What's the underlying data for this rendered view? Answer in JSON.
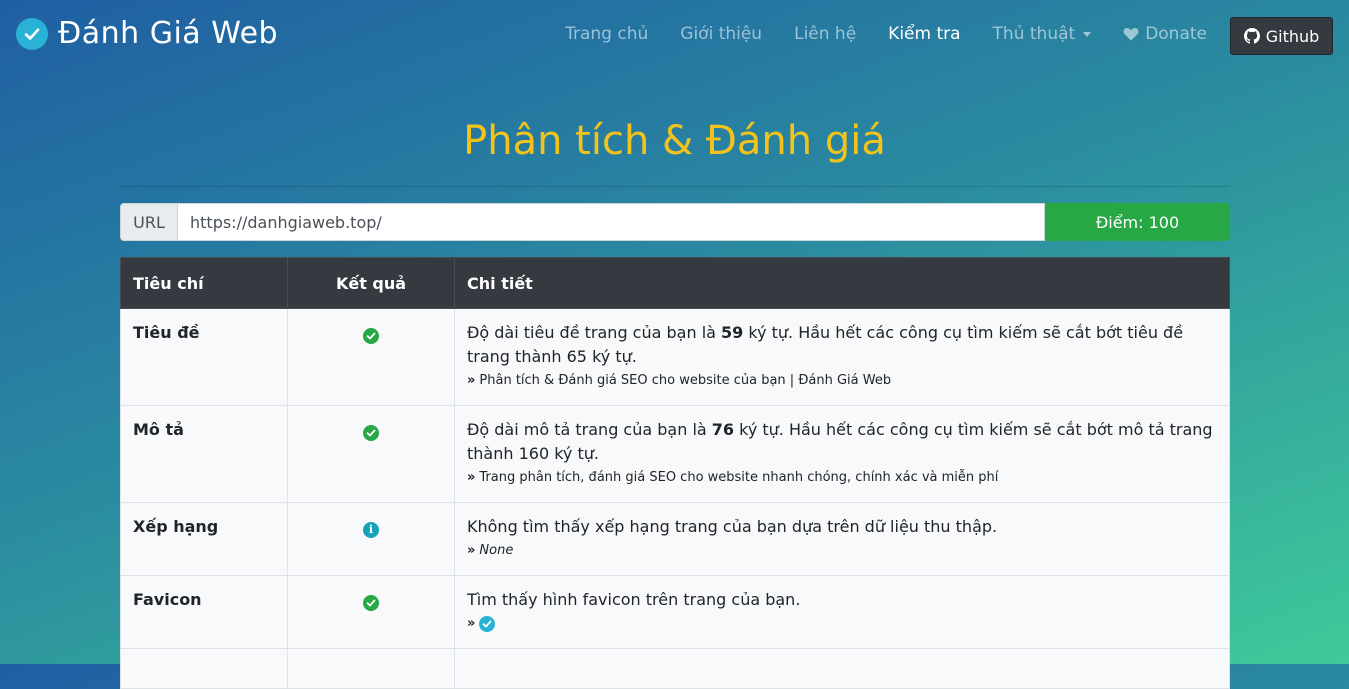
{
  "brand": {
    "name": "Đánh Giá Web"
  },
  "nav": {
    "items": [
      {
        "label": "Trang chủ"
      },
      {
        "label": "Giới thiệu"
      },
      {
        "label": "Liên hệ"
      },
      {
        "label": "Kiểm tra"
      },
      {
        "label": "Thủ thuật"
      },
      {
        "label": "Donate"
      }
    ],
    "github_label": "Github"
  },
  "page": {
    "title": "Phân tích & Đánh giá"
  },
  "url_bar": {
    "label": "URL",
    "value": "https://danhgiaweb.top/",
    "score_label": "Điểm: 100"
  },
  "table": {
    "headers": {
      "criteria": "Tiêu chí",
      "result": "Kết quả",
      "detail": "Chi tiết"
    },
    "rows": [
      {
        "criteria": "Tiêu đề",
        "status": "ok",
        "detail_pre": "Độ dài tiêu đề trang của bạn là ",
        "detail_num": "59",
        "detail_post": " ký tự. Hầu hết các công cụ tìm kiếm sẽ cắt bớt tiêu đề trang thành 65 ký tự.",
        "note": "Phân tích & Đánh giá SEO cho website của bạn | Đánh Giá Web"
      },
      {
        "criteria": "Mô tả",
        "status": "ok",
        "detail_pre": "Độ dài mô tả trang của bạn là ",
        "detail_num": "76",
        "detail_post": " ký tự. Hầu hết các công cụ tìm kiếm sẽ cắt bớt mô tả trang thành 160 ký tự.",
        "note": "Trang phân tích, đánh giá SEO cho website nhanh chóng, chính xác và miễn phí"
      },
      {
        "criteria": "Xếp hạng",
        "status": "info",
        "detail": "Không tìm thấy xếp hạng trang của bạn dựa trên dữ liệu thu thập.",
        "note": "None"
      },
      {
        "criteria": "Favicon",
        "status": "ok",
        "detail": "Tìm thấy hình favicon trên trang của bạn."
      }
    ]
  },
  "colors": {
    "accent_title": "#f3c31b",
    "success": "#28a745",
    "info": "#17a2b8",
    "dark": "#343a40"
  }
}
